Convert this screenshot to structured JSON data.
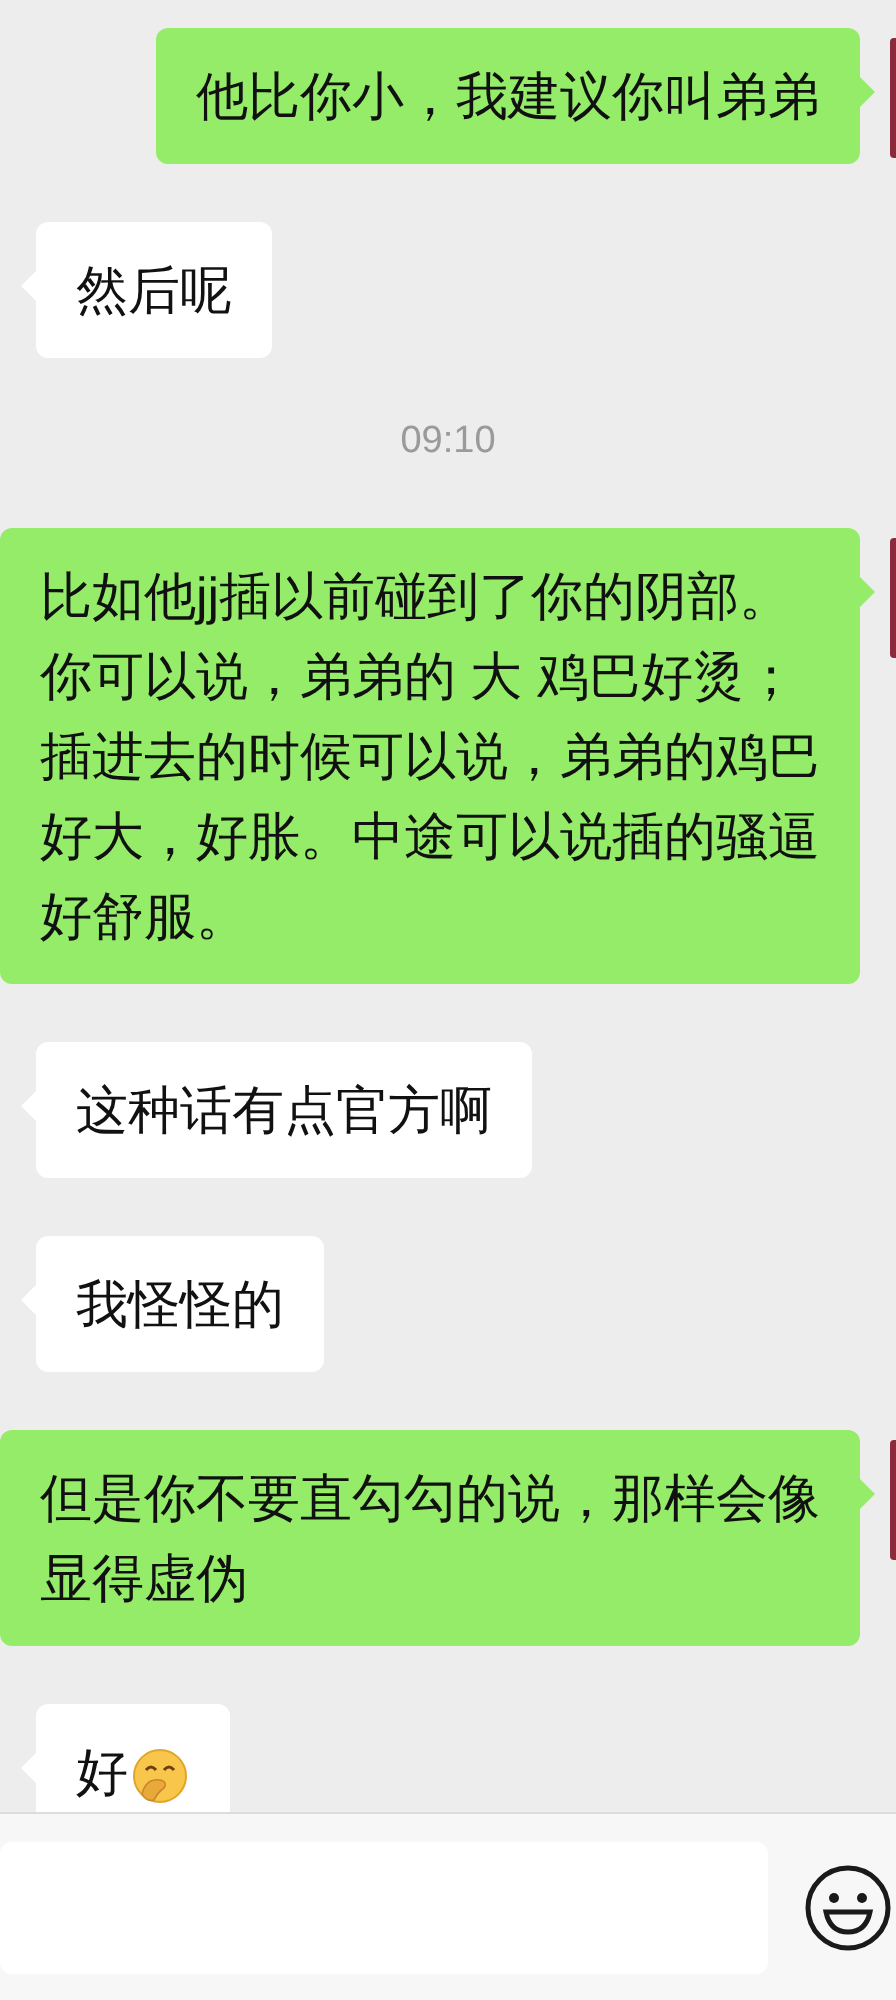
{
  "messages": [
    {
      "kind": "text",
      "outgoing": true,
      "text": "他比你小，我建议你叫弟弟"
    },
    {
      "kind": "text",
      "outgoing": false,
      "text": "然后呢"
    },
    {
      "kind": "time",
      "text": "09:10"
    },
    {
      "kind": "text",
      "outgoing": true,
      "text": "比如他jj插以前碰到了你的阴部。你可以说，弟弟的 大 鸡巴好烫；插进去的时候可以说，弟弟的鸡巴好大，好胀。中途可以说插的骚逼好舒服。"
    },
    {
      "kind": "text",
      "outgoing": false,
      "text": "这种话有点官方啊"
    },
    {
      "kind": "text",
      "outgoing": false,
      "text": "我怪怪的"
    },
    {
      "kind": "text",
      "outgoing": true,
      "text": "但是你不要直勾勾的说，那样会像显得虚伪"
    },
    {
      "kind": "emoji",
      "outgoing": false,
      "text": "好"
    }
  ]
}
